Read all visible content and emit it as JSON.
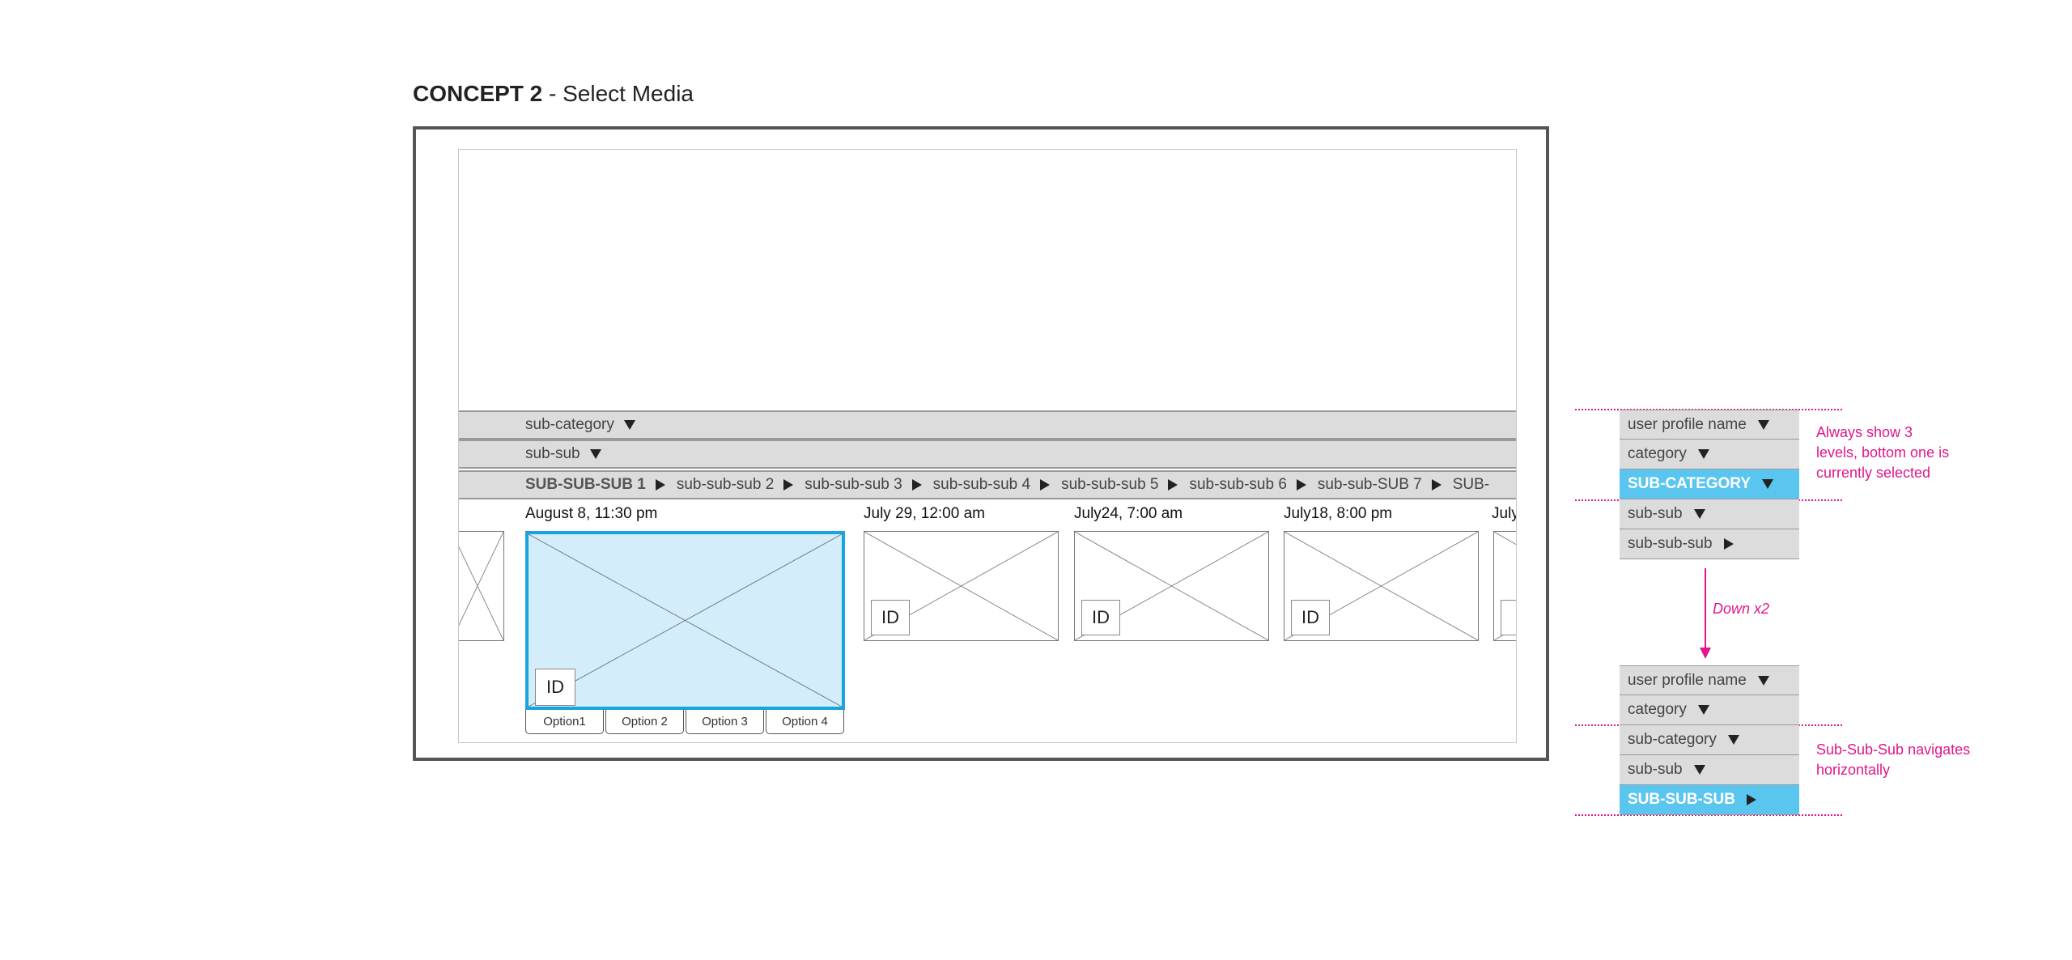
{
  "title": {
    "bold": "CONCEPT 2",
    "rest": " - Select Media"
  },
  "bars": {
    "sub_category": "sub-category",
    "sub_sub": "sub-sub",
    "crumbs": [
      "SUB-SUB-SUB 1",
      "sub-sub-sub 2",
      "sub-sub-sub 3",
      "sub-sub-sub 4",
      "sub-sub-sub 5",
      "sub-sub-sub 6",
      "sub-sub-SUB 7",
      "SUB-"
    ]
  },
  "media": {
    "dates": [
      "August 8, 11:30 pm",
      "July 29, 12:00 am",
      "July24, 7:00 am",
      "July18, 8:00 pm",
      "July"
    ],
    "id_label": "ID",
    "partial_id": "I",
    "options": [
      "Option1",
      "Option 2",
      "Option 3",
      "Option 4"
    ]
  },
  "menu_top": {
    "items": [
      "user profile name",
      "category",
      "SUB-CATEGORY",
      "sub-sub",
      "sub-sub-sub"
    ]
  },
  "menu_bottom": {
    "items": [
      "user profile name",
      "category",
      "sub-category",
      "sub-sub",
      "SUB-SUB-SUB"
    ]
  },
  "annotations": {
    "note_top": [
      "Always show 3",
      "levels, bottom one is",
      "currently selected"
    ],
    "down": "Down x2",
    "note_bottom": [
      "Sub-Sub-Sub navigates",
      "horizontally"
    ]
  },
  "colors": {
    "accent": "#e0168a",
    "highlight": "#5ac6f0",
    "selected_border": "#1aa3e0",
    "selected_fill": "#d3eefa"
  }
}
